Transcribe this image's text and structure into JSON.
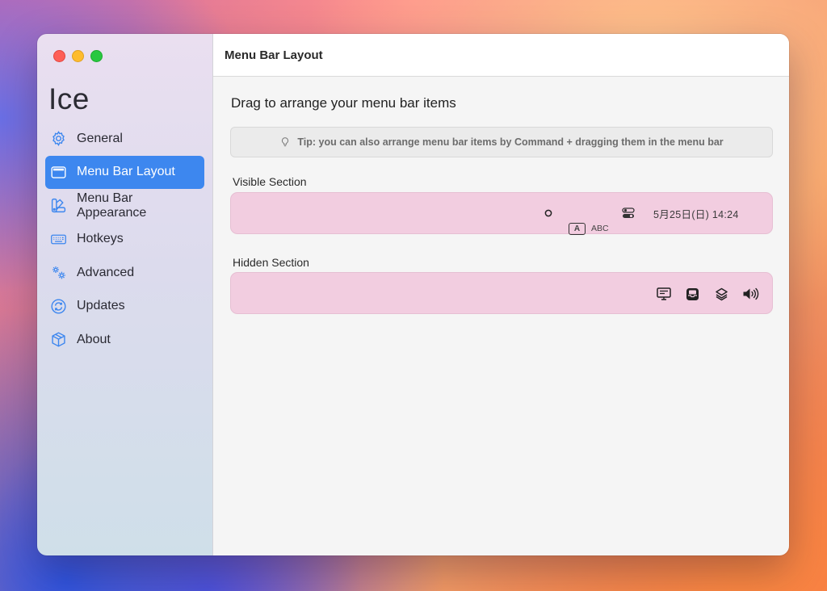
{
  "sidebar": {
    "app_title": "Ice",
    "items": [
      {
        "label": "General",
        "icon": "gear-icon",
        "active": false
      },
      {
        "label": "Menu Bar Layout",
        "icon": "menubar-layout-icon",
        "active": true
      },
      {
        "label": "Menu Bar Appearance",
        "icon": "swatch-icon",
        "active": false
      },
      {
        "label": "Hotkeys",
        "icon": "keyboard-icon",
        "active": false
      },
      {
        "label": "Advanced",
        "icon": "gears-icon",
        "active": false
      },
      {
        "label": "Updates",
        "icon": "refresh-icon",
        "active": false
      },
      {
        "label": "About",
        "icon": "cube-icon",
        "active": false
      }
    ]
  },
  "main": {
    "window_title": "Menu Bar Layout",
    "heading": "Drag to arrange your menu bar items",
    "tip": {
      "icon": "lightbulb-icon",
      "text": "Tip: you can also arrange menu bar items by Command + dragging them in the menu bar"
    },
    "visible_section": {
      "label": "Visible Section",
      "items": [
        {
          "icon": "circle-icon"
        },
        {
          "label": "ABC",
          "icon": "input-source-icon",
          "glyph": "A"
        },
        {
          "icon": "control-center-icon"
        },
        {
          "label": "5月25日(日)  14:24",
          "icon": "clock"
        }
      ]
    },
    "hidden_section": {
      "label": "Hidden Section",
      "items": [
        {
          "icon": "display-icon"
        },
        {
          "icon": "inbox-tray-icon"
        },
        {
          "icon": "layers-icon"
        },
        {
          "icon": "speaker-volume-icon"
        }
      ]
    }
  },
  "colors": {
    "accent": "#3d87ef",
    "section_bg": "#f2cde0",
    "traffic_red": "#fe5f57",
    "traffic_yellow": "#febc2e",
    "traffic_green": "#28c840"
  }
}
